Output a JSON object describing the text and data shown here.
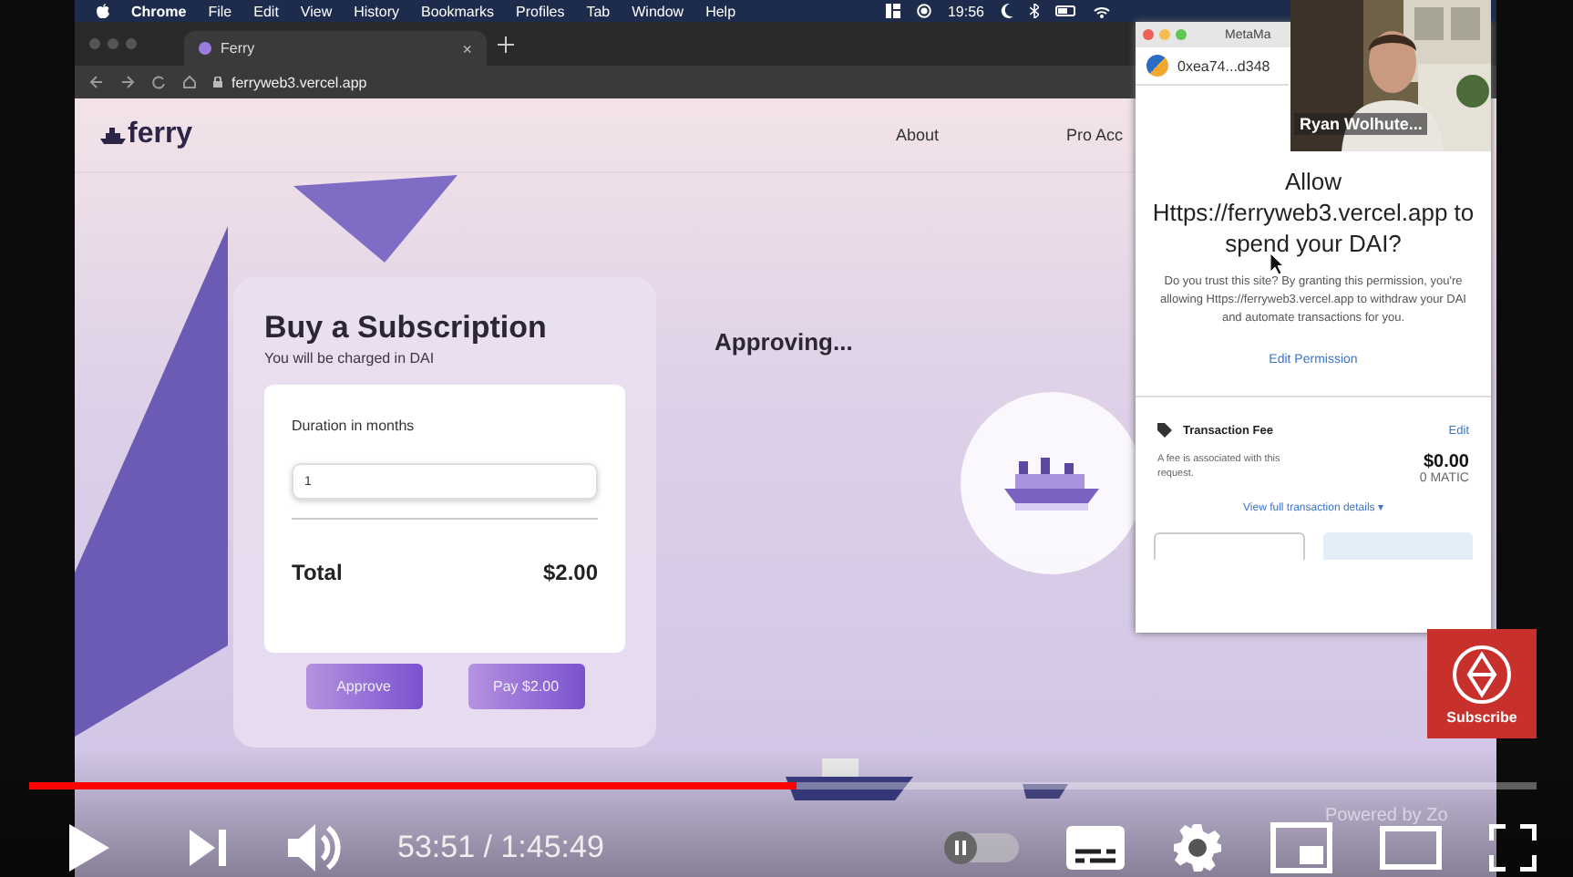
{
  "menubar": {
    "app": "Chrome",
    "menus": [
      "File",
      "Edit",
      "View",
      "History",
      "Bookmarks",
      "Profiles",
      "Tab",
      "Window",
      "Help"
    ],
    "clock": "19:56"
  },
  "browser": {
    "tab": {
      "title": "Ferry",
      "close": "×"
    },
    "url": "ferryweb3.vercel.app"
  },
  "site": {
    "logo": "ferry",
    "nav": [
      "About",
      "Pro Acc"
    ],
    "card": {
      "title": "Buy a Subscription",
      "subtitle": "You will be charged in DAI",
      "duration_label": "Duration in months",
      "duration_value": "1",
      "total_label": "Total",
      "total_value": "$2.00",
      "buttons": [
        "Approve",
        "Pay $2.00"
      ]
    },
    "status": "Approving..."
  },
  "metamask": {
    "title": "MetaMa",
    "account": "0xea74...d348",
    "heading": "Allow Https://ferryweb3.vercel.app to spend your DAI?",
    "body": "Do you trust this site? By granting this permission, you're allowing Https://ferryweb3.vercel.app to withdraw your DAI and automate transactions for you.",
    "edit_permission": "Edit Permission",
    "fee_title": "Transaction Fee",
    "fee_edit": "Edit",
    "fee_note": "A fee is associated with this request.",
    "fee_amount": "$0.00",
    "fee_token": "0 MATIC",
    "details_link": "View full transaction details ▾"
  },
  "webcam": {
    "name": "Ryan Wolhute..."
  },
  "subscribe": "Subscribe",
  "zoom_caption": "Powered by Zo",
  "player": {
    "progress": {
      "level": 0.509
    },
    "time": "53:51 / 1:45:49",
    "autoplay": {
      "on": false
    }
  }
}
